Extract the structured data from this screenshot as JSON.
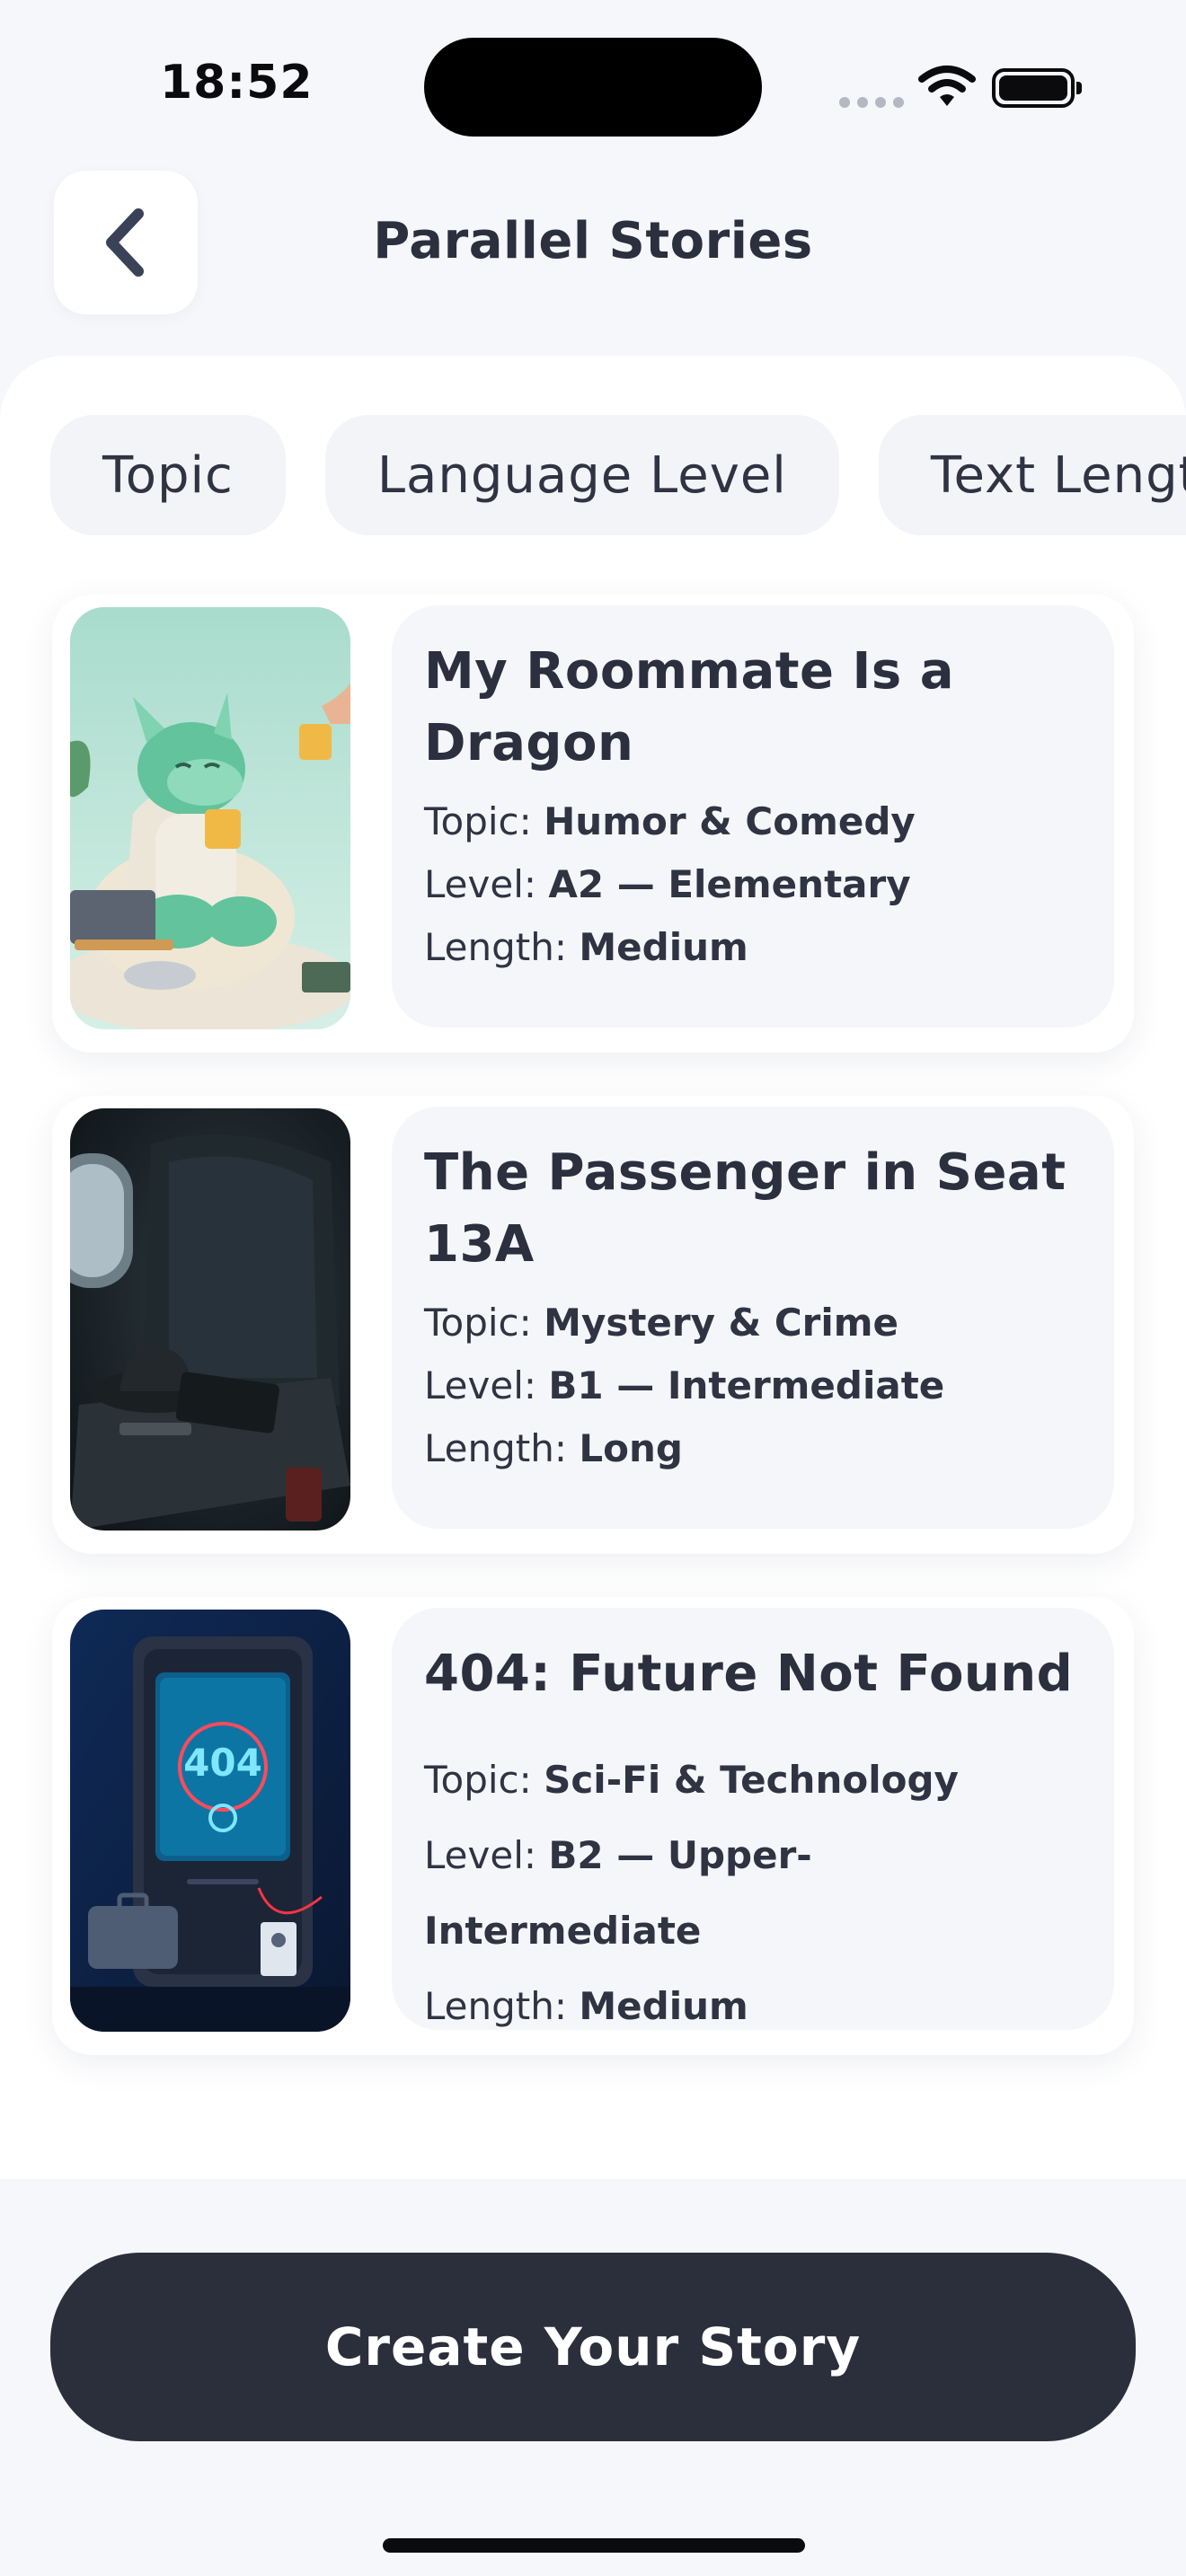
{
  "status_bar": {
    "time": "18:52"
  },
  "header": {
    "title": "Parallel Stories"
  },
  "filters": [
    "Topic",
    "Language Level",
    "Text Length"
  ],
  "stories": [
    {
      "title": "My Roommate Is a Dragon",
      "topic_label": "Topic:",
      "topic": "Humor & Comedy",
      "level_label": "Level:",
      "level": "A2 — Elementary",
      "length_label": "Length:",
      "length": "Medium"
    },
    {
      "title": "The Passenger in Seat 13A",
      "topic_label": "Topic:",
      "topic": "Mystery & Crime",
      "level_label": "Level:",
      "level": "B1 — Intermediate",
      "length_label": "Length:",
      "length": "Long"
    },
    {
      "title": "404: Future Not Found",
      "topic_label": "Topic:",
      "topic": "Sci-Fi & Technology",
      "level_label": "Level:",
      "level": "B2 — Upper-Intermediate",
      "length_label": "Length:",
      "length": "Medium",
      "image_text": "404"
    }
  ],
  "cta": {
    "label": "Create Your Story"
  },
  "colors": {
    "background": "#f6f7fb",
    "primary": "#2b2e3b",
    "card": "#f5f6fa"
  }
}
